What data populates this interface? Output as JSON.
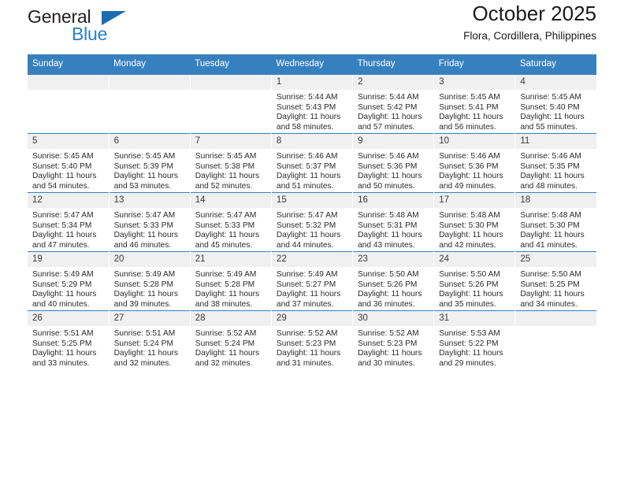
{
  "brand": {
    "general_text": "General",
    "blue_text": "Blue",
    "triangle_color": "#1b6cb3",
    "blue_color": "#2a7fc9"
  },
  "header": {
    "title": "October 2025",
    "subtitle": "Flora, Cordillera, Philippines"
  },
  "theme": {
    "header_blue": "#3780c0",
    "daynum_band": "#f0f0f0",
    "text": "#2b2b2b"
  },
  "weekdays": [
    "Sunday",
    "Monday",
    "Tuesday",
    "Wednesday",
    "Thursday",
    "Friday",
    "Saturday"
  ],
  "labels": {
    "sunrise_prefix": "Sunrise:",
    "sunset_prefix": "Sunset:",
    "daylight_prefix": "Daylight:"
  },
  "weeks": [
    [
      {
        "day": ""
      },
      {
        "day": ""
      },
      {
        "day": ""
      },
      {
        "day": "1",
        "sunrise": "Sunrise: 5:44 AM",
        "sunset": "Sunset: 5:43 PM",
        "daylight_1": "Daylight: 11 hours",
        "daylight_2": "and 58 minutes."
      },
      {
        "day": "2",
        "sunrise": "Sunrise: 5:44 AM",
        "sunset": "Sunset: 5:42 PM",
        "daylight_1": "Daylight: 11 hours",
        "daylight_2": "and 57 minutes."
      },
      {
        "day": "3",
        "sunrise": "Sunrise: 5:45 AM",
        "sunset": "Sunset: 5:41 PM",
        "daylight_1": "Daylight: 11 hours",
        "daylight_2": "and 56 minutes."
      },
      {
        "day": "4",
        "sunrise": "Sunrise: 5:45 AM",
        "sunset": "Sunset: 5:40 PM",
        "daylight_1": "Daylight: 11 hours",
        "daylight_2": "and 55 minutes."
      }
    ],
    [
      {
        "day": "5",
        "sunrise": "Sunrise: 5:45 AM",
        "sunset": "Sunset: 5:40 PM",
        "daylight_1": "Daylight: 11 hours",
        "daylight_2": "and 54 minutes."
      },
      {
        "day": "6",
        "sunrise": "Sunrise: 5:45 AM",
        "sunset": "Sunset: 5:39 PM",
        "daylight_1": "Daylight: 11 hours",
        "daylight_2": "and 53 minutes."
      },
      {
        "day": "7",
        "sunrise": "Sunrise: 5:45 AM",
        "sunset": "Sunset: 5:38 PM",
        "daylight_1": "Daylight: 11 hours",
        "daylight_2": "and 52 minutes."
      },
      {
        "day": "8",
        "sunrise": "Sunrise: 5:46 AM",
        "sunset": "Sunset: 5:37 PM",
        "daylight_1": "Daylight: 11 hours",
        "daylight_2": "and 51 minutes."
      },
      {
        "day": "9",
        "sunrise": "Sunrise: 5:46 AM",
        "sunset": "Sunset: 5:36 PM",
        "daylight_1": "Daylight: 11 hours",
        "daylight_2": "and 50 minutes."
      },
      {
        "day": "10",
        "sunrise": "Sunrise: 5:46 AM",
        "sunset": "Sunset: 5:36 PM",
        "daylight_1": "Daylight: 11 hours",
        "daylight_2": "and 49 minutes."
      },
      {
        "day": "11",
        "sunrise": "Sunrise: 5:46 AM",
        "sunset": "Sunset: 5:35 PM",
        "daylight_1": "Daylight: 11 hours",
        "daylight_2": "and 48 minutes."
      }
    ],
    [
      {
        "day": "12",
        "sunrise": "Sunrise: 5:47 AM",
        "sunset": "Sunset: 5:34 PM",
        "daylight_1": "Daylight: 11 hours",
        "daylight_2": "and 47 minutes."
      },
      {
        "day": "13",
        "sunrise": "Sunrise: 5:47 AM",
        "sunset": "Sunset: 5:33 PM",
        "daylight_1": "Daylight: 11 hours",
        "daylight_2": "and 46 minutes."
      },
      {
        "day": "14",
        "sunrise": "Sunrise: 5:47 AM",
        "sunset": "Sunset: 5:33 PM",
        "daylight_1": "Daylight: 11 hours",
        "daylight_2": "and 45 minutes."
      },
      {
        "day": "15",
        "sunrise": "Sunrise: 5:47 AM",
        "sunset": "Sunset: 5:32 PM",
        "daylight_1": "Daylight: 11 hours",
        "daylight_2": "and 44 minutes."
      },
      {
        "day": "16",
        "sunrise": "Sunrise: 5:48 AM",
        "sunset": "Sunset: 5:31 PM",
        "daylight_1": "Daylight: 11 hours",
        "daylight_2": "and 43 minutes."
      },
      {
        "day": "17",
        "sunrise": "Sunrise: 5:48 AM",
        "sunset": "Sunset: 5:30 PM",
        "daylight_1": "Daylight: 11 hours",
        "daylight_2": "and 42 minutes."
      },
      {
        "day": "18",
        "sunrise": "Sunrise: 5:48 AM",
        "sunset": "Sunset: 5:30 PM",
        "daylight_1": "Daylight: 11 hours",
        "daylight_2": "and 41 minutes."
      }
    ],
    [
      {
        "day": "19",
        "sunrise": "Sunrise: 5:49 AM",
        "sunset": "Sunset: 5:29 PM",
        "daylight_1": "Daylight: 11 hours",
        "daylight_2": "and 40 minutes."
      },
      {
        "day": "20",
        "sunrise": "Sunrise: 5:49 AM",
        "sunset": "Sunset: 5:28 PM",
        "daylight_1": "Daylight: 11 hours",
        "daylight_2": "and 39 minutes."
      },
      {
        "day": "21",
        "sunrise": "Sunrise: 5:49 AM",
        "sunset": "Sunset: 5:28 PM",
        "daylight_1": "Daylight: 11 hours",
        "daylight_2": "and 38 minutes."
      },
      {
        "day": "22",
        "sunrise": "Sunrise: 5:49 AM",
        "sunset": "Sunset: 5:27 PM",
        "daylight_1": "Daylight: 11 hours",
        "daylight_2": "and 37 minutes."
      },
      {
        "day": "23",
        "sunrise": "Sunrise: 5:50 AM",
        "sunset": "Sunset: 5:26 PM",
        "daylight_1": "Daylight: 11 hours",
        "daylight_2": "and 36 minutes."
      },
      {
        "day": "24",
        "sunrise": "Sunrise: 5:50 AM",
        "sunset": "Sunset: 5:26 PM",
        "daylight_1": "Daylight: 11 hours",
        "daylight_2": "and 35 minutes."
      },
      {
        "day": "25",
        "sunrise": "Sunrise: 5:50 AM",
        "sunset": "Sunset: 5:25 PM",
        "daylight_1": "Daylight: 11 hours",
        "daylight_2": "and 34 minutes."
      }
    ],
    [
      {
        "day": "26",
        "sunrise": "Sunrise: 5:51 AM",
        "sunset": "Sunset: 5:25 PM",
        "daylight_1": "Daylight: 11 hours",
        "daylight_2": "and 33 minutes."
      },
      {
        "day": "27",
        "sunrise": "Sunrise: 5:51 AM",
        "sunset": "Sunset: 5:24 PM",
        "daylight_1": "Daylight: 11 hours",
        "daylight_2": "and 32 minutes."
      },
      {
        "day": "28",
        "sunrise": "Sunrise: 5:52 AM",
        "sunset": "Sunset: 5:24 PM",
        "daylight_1": "Daylight: 11 hours",
        "daylight_2": "and 32 minutes."
      },
      {
        "day": "29",
        "sunrise": "Sunrise: 5:52 AM",
        "sunset": "Sunset: 5:23 PM",
        "daylight_1": "Daylight: 11 hours",
        "daylight_2": "and 31 minutes."
      },
      {
        "day": "30",
        "sunrise": "Sunrise: 5:52 AM",
        "sunset": "Sunset: 5:23 PM",
        "daylight_1": "Daylight: 11 hours",
        "daylight_2": "and 30 minutes."
      },
      {
        "day": "31",
        "sunrise": "Sunrise: 5:53 AM",
        "sunset": "Sunset: 5:22 PM",
        "daylight_1": "Daylight: 11 hours",
        "daylight_2": "and 29 minutes."
      },
      {
        "day": ""
      }
    ]
  ]
}
